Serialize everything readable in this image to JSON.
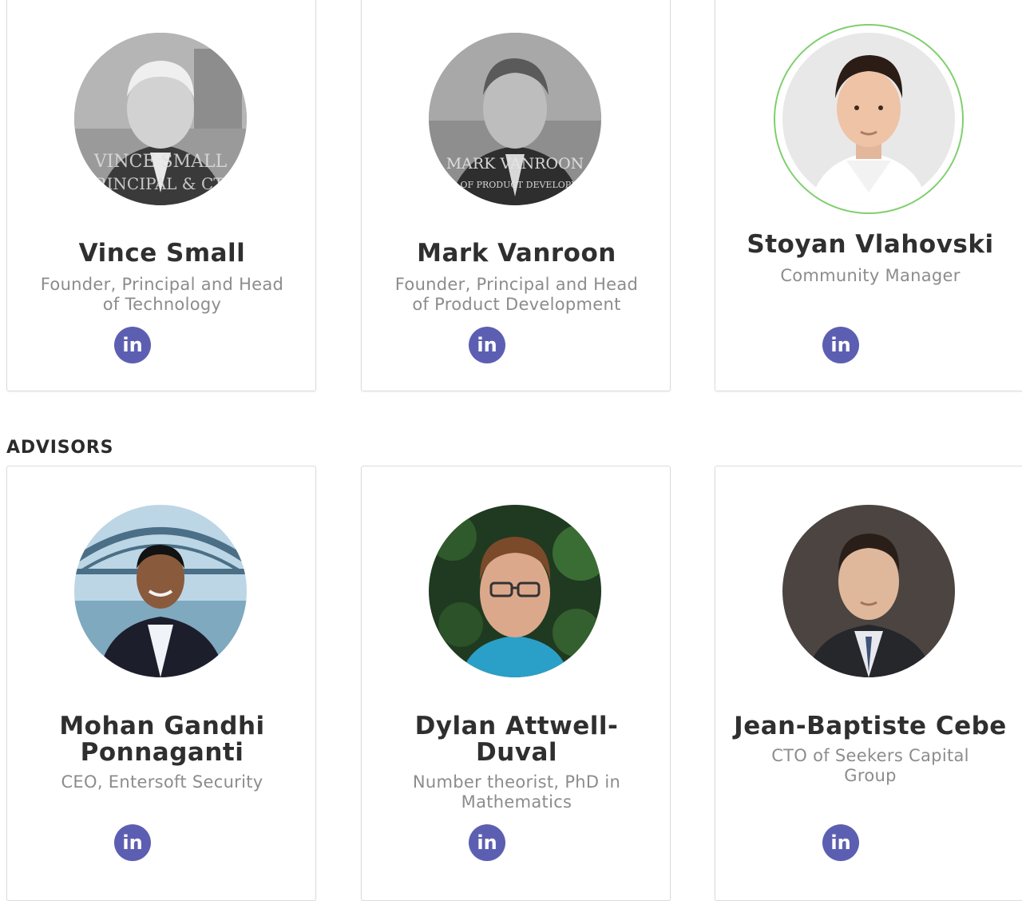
{
  "team": [
    {
      "name": "Vince Small",
      "role": "Founder, Principal and Head of Technology",
      "photo_caption_1": "VINCE SMALL",
      "photo_caption_2": "PRINCIPAL & CTO"
    },
    {
      "name": "Mark Vanroon",
      "role": "Founder, Principal and Head of Product Development",
      "photo_caption_1": "MARK VANROON",
      "photo_caption_2": "HEAD OF PRODUCT DEVELOPMENT"
    },
    {
      "name": "Stoyan Vlahovski",
      "role": "Community Manager"
    }
  ],
  "advisors_title": "ADVISORS",
  "advisors": [
    {
      "name": "Mohan Gandhi Ponnaganti",
      "role": "CEO, Entersoft Security"
    },
    {
      "name": "Dylan Attwell-Duval",
      "role": "Number theorist, PhD in Mathematics"
    },
    {
      "name": "Jean-Baptiste Cebe",
      "role": "CTO of Seekers Capital Group"
    }
  ],
  "linkedin_label": "in",
  "colors": {
    "linkedin": "#5c5fb1",
    "highlight_ring": "#7fcf6e",
    "name": "#2f2f2f",
    "role": "#8c8c8c"
  },
  "icons": {
    "social": "linkedin-icon"
  }
}
